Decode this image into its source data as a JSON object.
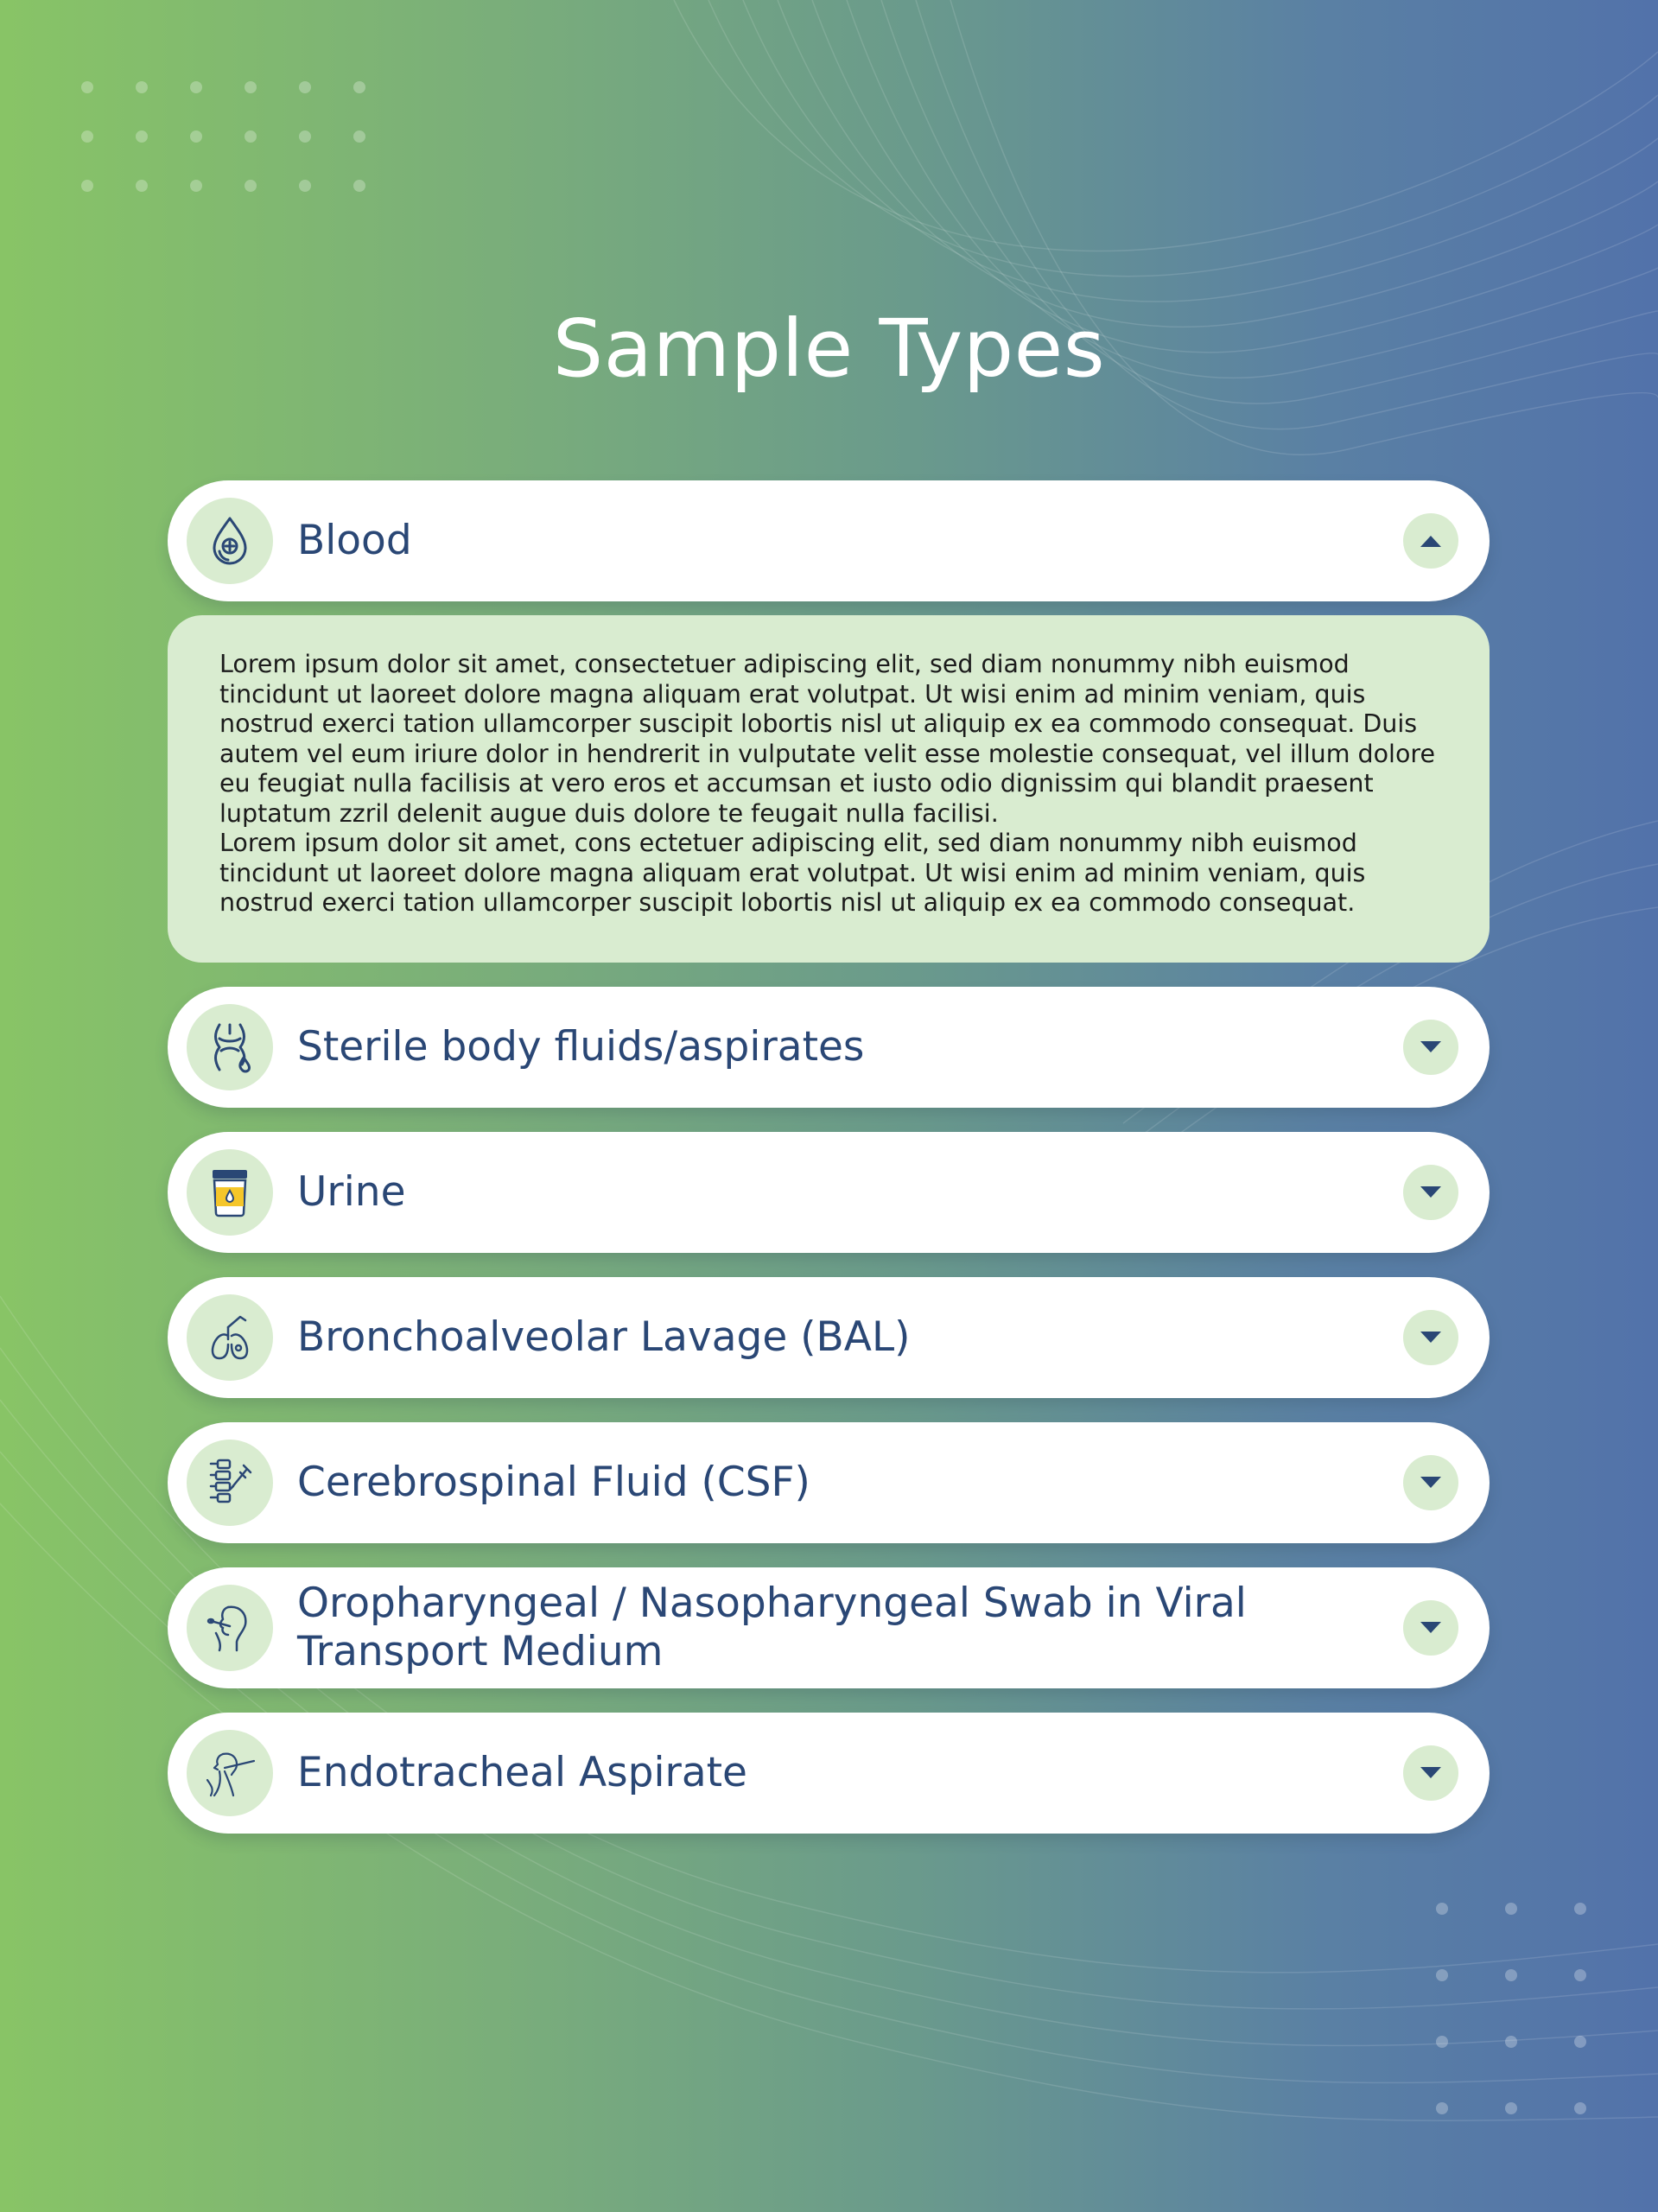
{
  "page": {
    "title": "Sample Types"
  },
  "colors": {
    "heading": "#2a4775",
    "panel_bg": "#d9ecd0",
    "card_bg": "#ffffff",
    "title": "#ffffff"
  },
  "sample_types": [
    {
      "label": "Blood",
      "icon": "blood-drop-icon",
      "expanded": true,
      "toggle": "chevron-up-icon"
    },
    {
      "label": "Sterile body fluids/aspirates",
      "icon": "body-fluid-icon",
      "expanded": false,
      "toggle": "chevron-down-icon"
    },
    {
      "label": "Urine",
      "icon": "urine-cup-icon",
      "expanded": false,
      "toggle": "chevron-down-icon"
    },
    {
      "label": "Bronchoalveolar Lavage (BAL)",
      "icon": "lungs-icon",
      "expanded": false,
      "toggle": "chevron-down-icon"
    },
    {
      "label": "Cerebrospinal Fluid (CSF)",
      "icon": "spine-syringe-icon",
      "expanded": false,
      "toggle": "chevron-down-icon"
    },
    {
      "label": "Oropharyngeal / Nasopharyngeal Swab in Viral Transport Medium",
      "icon": "throat-swab-icon",
      "expanded": false,
      "toggle": "chevron-down-icon"
    },
    {
      "label": "Endotracheal Aspirate",
      "icon": "intubation-icon",
      "expanded": false,
      "toggle": "chevron-down-icon"
    }
  ],
  "blood_panel": {
    "paragraph_1": "Lorem ipsum dolor sit amet, consectetuer adipiscing elit, sed diam nonummy nibh euismod tincidunt ut laoreet dolore magna aliquam erat volutpat. Ut wisi enim ad minim veniam, quis nostrud exerci tation ullamcorper suscipit lobortis nisl ut aliquip ex ea commodo consequat. Duis autem vel eum iriure dolor in hendrerit in vulputate velit esse molestie consequat, vel illum dolore eu feugiat nulla facilisis at vero eros et accumsan et iusto odio dignissim qui blandit praesent luptatum zzril delenit augue duis dolore te feugait nulla facilisi.",
    "paragraph_2": "Lorem ipsum dolor sit amet, cons ectetuer adipiscing elit, sed diam nonummy nibh euismod tincidunt ut laoreet dolore magna aliquam erat volutpat. Ut wisi enim ad minim veniam, quis nostrud exerci tation ullamcorper suscipit lobortis nisl ut aliquip ex ea commodo consequat."
  }
}
